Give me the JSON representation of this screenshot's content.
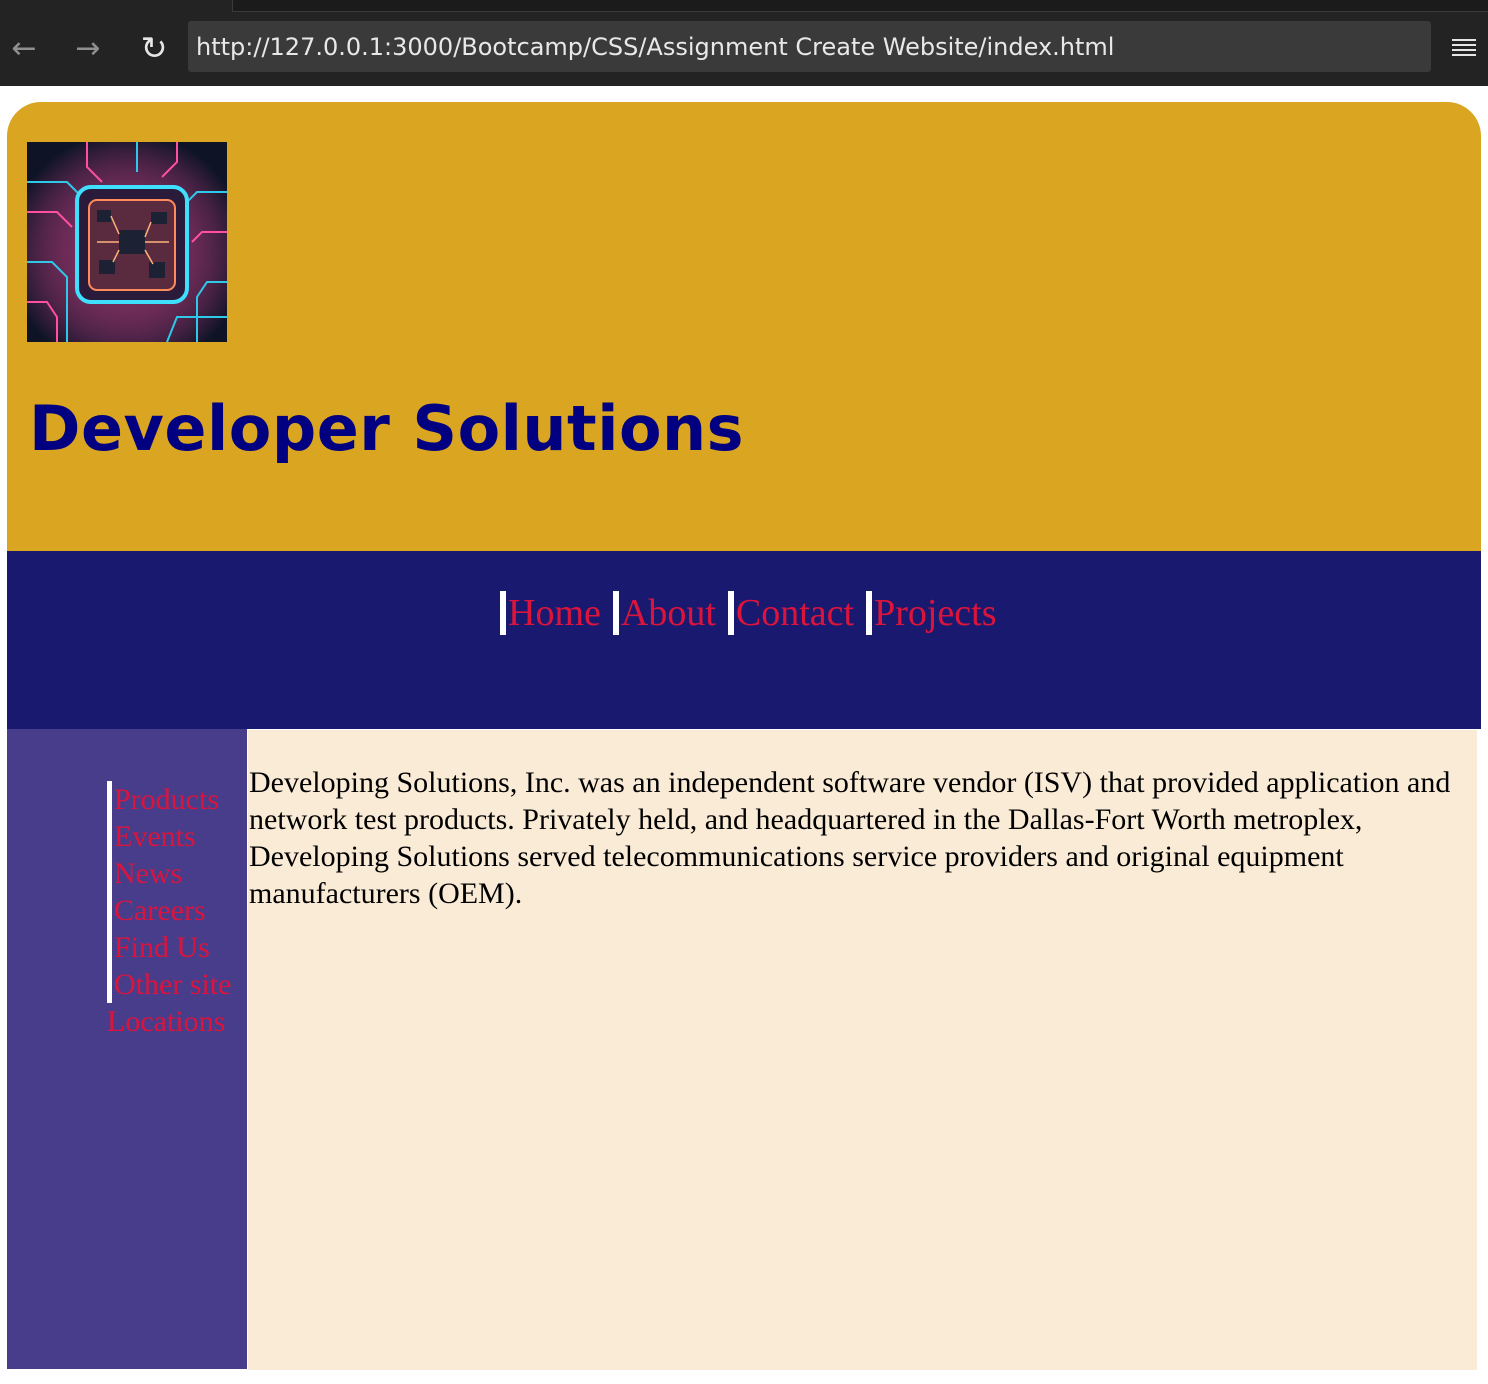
{
  "browser": {
    "url": "http://127.0.0.1:3000/Bootcamp/CSS/Assignment Create Website/index.html",
    "icons": {
      "back": "arrow-left-icon",
      "forward": "arrow-right-icon",
      "reload": "reload-icon",
      "menu": "hamburger-menu-icon"
    }
  },
  "header": {
    "title": "Developer Solutions",
    "logo": "circuit-chip-logo"
  },
  "top_nav": {
    "items": [
      {
        "label": "Home"
      },
      {
        "label": "About"
      },
      {
        "label": "Contact"
      },
      {
        "label": "Projects"
      }
    ]
  },
  "sidebar": {
    "items": [
      {
        "label": "Products"
      },
      {
        "label": "Events"
      },
      {
        "label": "News"
      },
      {
        "label": "Careers"
      },
      {
        "label": "Find Us"
      },
      {
        "label": "Other site Locations"
      }
    ]
  },
  "main": {
    "paragraph": "Developing Solutions, Inc. was an independent software vendor (ISV) that provided application and network test products. Privately held, and headquartered in the Dallas-Fort Worth metroplex, Developing Solutions served telecommunications service providers and original equipment manufacturers (OEM)."
  },
  "colors": {
    "header_bg": "#daa520",
    "title": "#000080",
    "top_nav_bg": "#191970",
    "link": "#dc143c",
    "sidebar_bg": "#483d8b",
    "content_bg": "#faebd7"
  }
}
